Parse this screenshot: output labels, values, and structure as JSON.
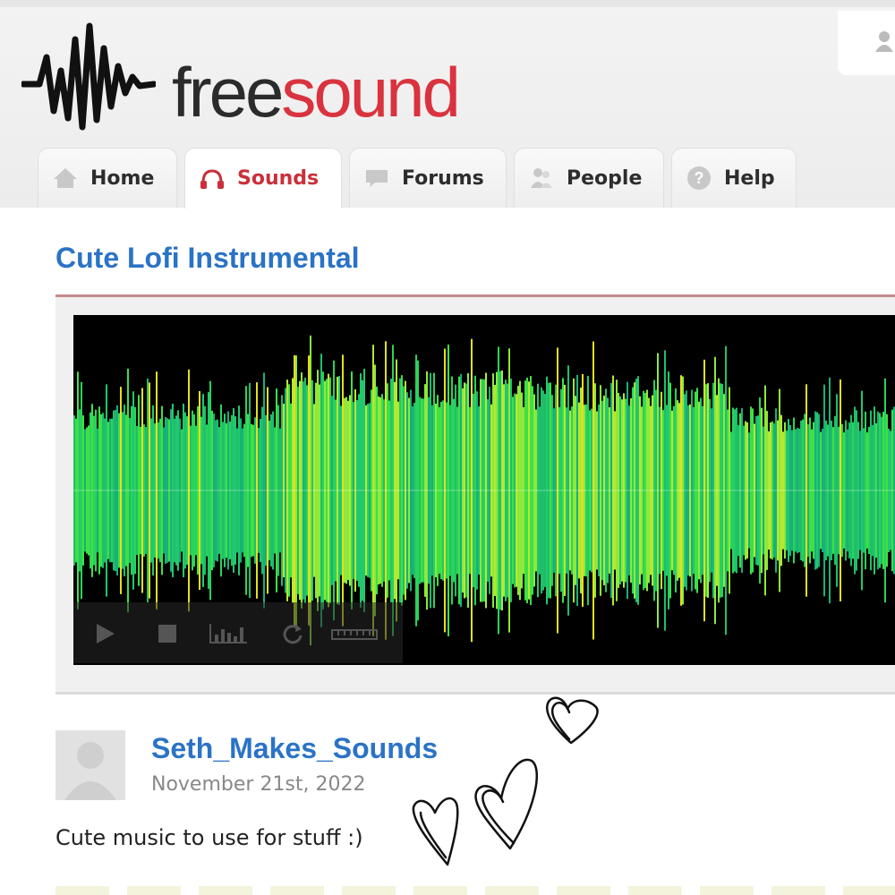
{
  "site": {
    "logo_free": "free",
    "logo_sound": "sound",
    "brand_color": "#d9333f",
    "link_color": "#2a73c6"
  },
  "nav": {
    "tabs": [
      {
        "label": "Home",
        "icon": "home-icon",
        "active": false
      },
      {
        "label": "Sounds",
        "icon": "headphones-icon",
        "active": true
      },
      {
        "label": "Forums",
        "icon": "speech-bubble-icon",
        "active": false
      },
      {
        "label": "People",
        "icon": "people-icon",
        "active": false
      },
      {
        "label": "Help",
        "icon": "help-icon",
        "active": false
      }
    ]
  },
  "sound": {
    "title": "Cute Lofi Instrumental",
    "uploader": "Seth_Makes_Sounds",
    "date": "November 21st, 2022",
    "description": "Cute music to use for stuff :)"
  },
  "player": {
    "controls": [
      "play-icon",
      "stop-icon",
      "spectrogram-toggle-icon",
      "loop-icon",
      "measure-icon"
    ]
  }
}
